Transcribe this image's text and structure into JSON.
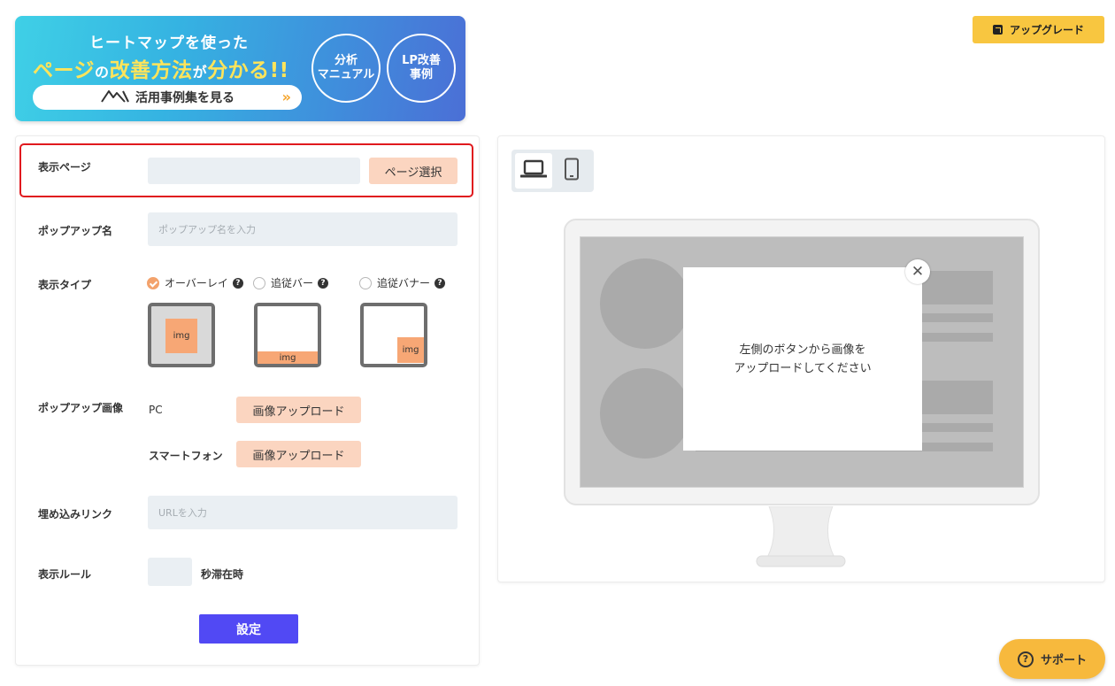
{
  "banner": {
    "line1": "ヒートマップを使った",
    "line2_a": "ページ",
    "line2_b": "の",
    "line2_c": "改善方法",
    "line2_d": "が",
    "line2_e": "分かる!!",
    "cta": "活用事例集を見る",
    "circle1": "分析\nマニュアル",
    "circle2": "LP改善\n事例",
    "gradient": [
      "#3fd0e6",
      "#4b6fd6"
    ]
  },
  "header": {
    "upgrade_label": "アップグレード"
  },
  "form": {
    "display_page": {
      "label": "表示ページ",
      "value": "",
      "button": "ページ選択"
    },
    "popup_name": {
      "label": "ポップアップ名",
      "placeholder": "ポップアップ名を入力"
    },
    "display_type": {
      "label": "表示タイプ",
      "options": [
        {
          "label": "オーバーレイ",
          "checked": true
        },
        {
          "label": "追従バー",
          "checked": false
        },
        {
          "label": "追従バナー",
          "checked": false
        }
      ],
      "thumb_text": "img"
    },
    "popup_image": {
      "label": "ポップアップ画像",
      "pc_label": "PC",
      "sp_label": "スマートフォン",
      "upload_button": "画像アップロード"
    },
    "embed_link": {
      "label": "埋め込みリンク",
      "placeholder": "URLを入力"
    },
    "display_rule": {
      "label": "表示ルール",
      "value": "",
      "suffix": "秒滞在時"
    },
    "submit": "設定"
  },
  "preview": {
    "devices": [
      {
        "icon": "laptop-icon",
        "active": true
      },
      {
        "icon": "smartphone-icon",
        "active": false
      }
    ],
    "popup_message": "左側のボタンから画像を\nアップロードしてください",
    "close_glyph": "✕"
  },
  "support": {
    "label": "サポート",
    "glyph": "?"
  },
  "colors": {
    "accent_yellow": "#f8c640",
    "peach": "#fbd5c0",
    "submit_blue": "#5149f4",
    "highlight_red": "#e0191e",
    "radio_checked": "#f3a26c"
  }
}
